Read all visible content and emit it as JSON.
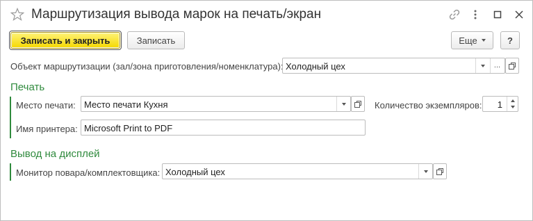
{
  "window": {
    "title": "Маршрутизация вывода марок на печать/экран"
  },
  "toolbar": {
    "save_close_label": "Записать и закрыть",
    "save_label": "Записать",
    "more_label": "Еще",
    "help_label": "?"
  },
  "routing_object": {
    "label": "Объект маршрутизации (зал/зона приготовления/номенклатура):",
    "value": "Холодный цех"
  },
  "print_section": {
    "title": "Печать",
    "print_place_label": "Место печати:",
    "print_place_value": "Место печати Кухня",
    "copies_label": "Количество экземпляров:",
    "copies_value": "1",
    "printer_label": "Имя принтера:",
    "printer_value": "Microsoft Print to PDF"
  },
  "display_section": {
    "title": "Вывод на дисплей",
    "monitor_label": "Монитор повара/комплектовщика:",
    "monitor_value": "Холодный цех"
  },
  "colors": {
    "accent_green": "#2f8a3d",
    "primary_button": "#f5d800"
  },
  "icons": {
    "favorite": "star-icon",
    "link": "link-icon",
    "menu": "more-vertical-icon",
    "maximize": "maximize-icon",
    "close": "close-icon",
    "dropdown": "chevron-down-icon",
    "open": "open-form-icon"
  }
}
